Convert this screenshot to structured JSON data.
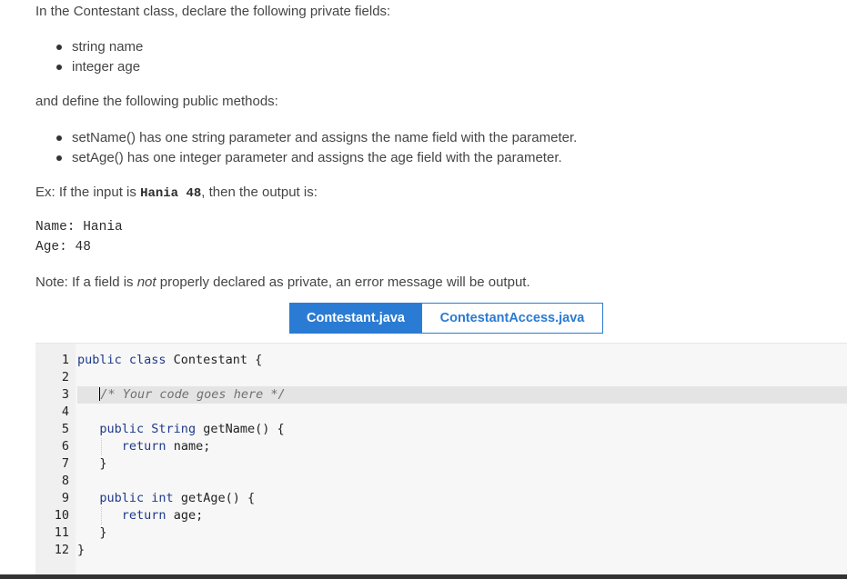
{
  "instructions": {
    "intro": "In the Contestant class, declare the following private fields:",
    "fields": [
      "string name",
      "integer age"
    ],
    "methods_intro": "and define the following public methods:",
    "methods": [
      "setName() has one string parameter and assigns the name field with the parameter.",
      "setAge() has one integer parameter and assigns the age field with the parameter."
    ],
    "example_prefix": "Ex: If the input is ",
    "example_input": "Hania 48",
    "example_suffix": ", then the output is:",
    "output_lines": [
      "Name: Hania",
      "Age: 48"
    ],
    "note_prefix": "Note: If a field is ",
    "note_emphasis": "not",
    "note_suffix": " properly declared as private, an error message will be output."
  },
  "tabs": [
    {
      "label": "Contestant.java",
      "active": true
    },
    {
      "label": "ContestantAccess.java",
      "active": false
    }
  ],
  "editor": {
    "line_numbers": [
      "1",
      "2",
      "3",
      "4",
      "5",
      "6",
      "7",
      "8",
      "9",
      "10",
      "11",
      "12"
    ],
    "lines": [
      {
        "kw": "public class",
        "rest": " Contestant {"
      },
      {
        "rest": ""
      },
      {
        "comment": "/* Your code goes here */"
      },
      {
        "rest": ""
      },
      {
        "kw": "public",
        "type": " String",
        "rest": " getName() {"
      },
      {
        "kw": "return",
        "rest": " name;"
      },
      {
        "rest": "}"
      },
      {
        "rest": ""
      },
      {
        "kw": "public",
        "type": " int",
        "rest": " getAge() {"
      },
      {
        "kw": "return",
        "rest": " age;"
      },
      {
        "rest": "}"
      },
      {
        "rest": "}"
      }
    ]
  }
}
